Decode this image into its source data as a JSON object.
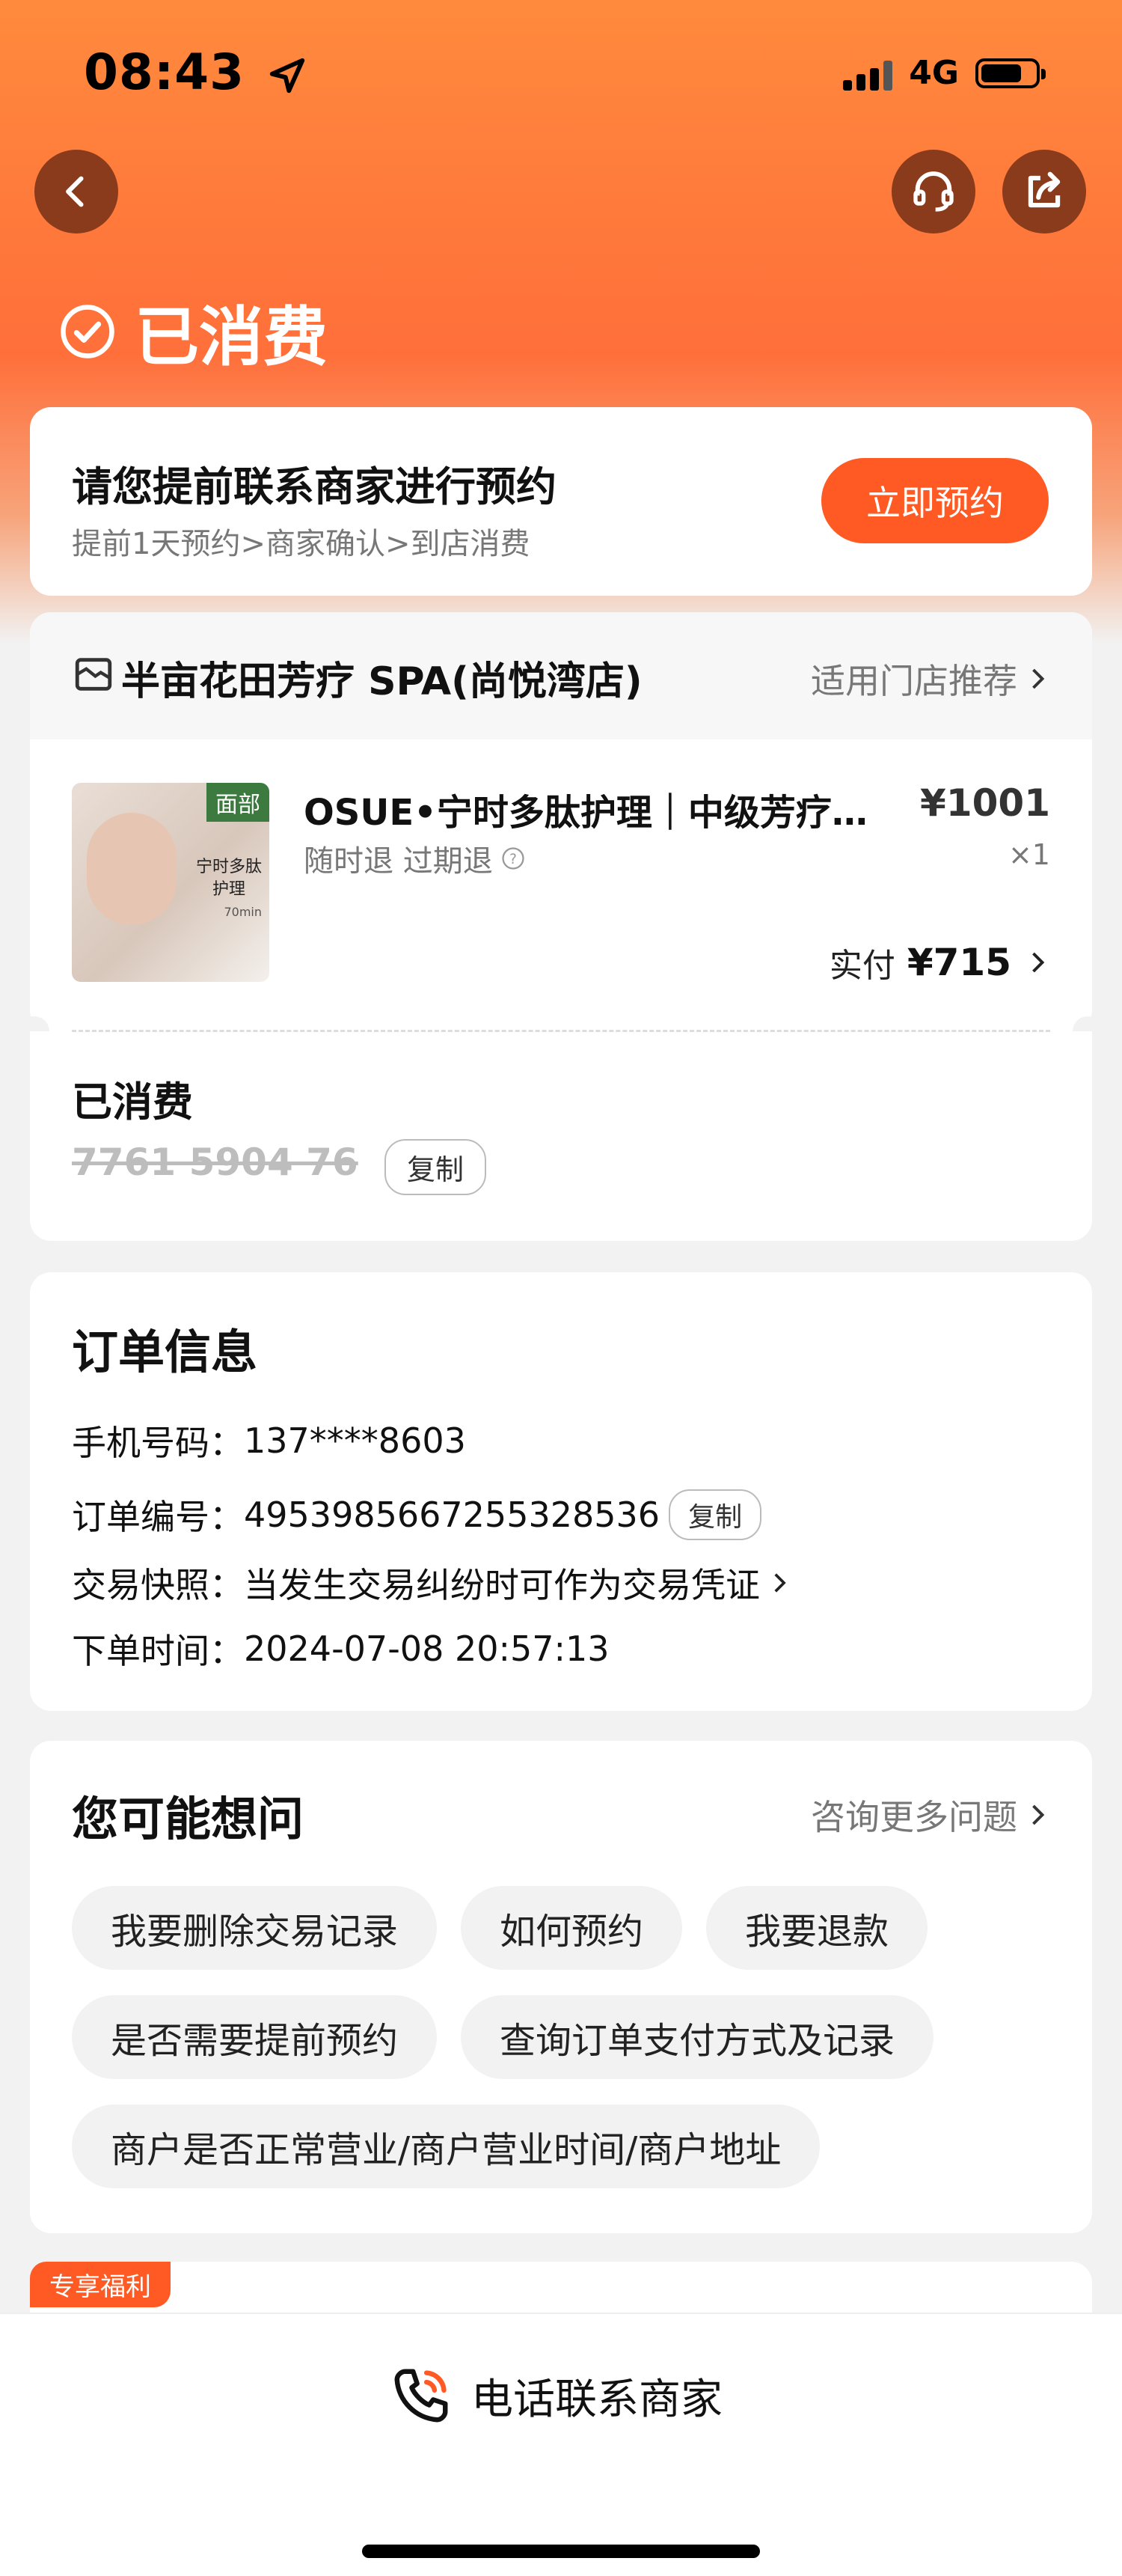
{
  "status_bar": {
    "time": "08:43",
    "network": "4G",
    "battery_level": 0.75
  },
  "header": {
    "status": "已消费"
  },
  "booking": {
    "title": "请您提前联系商家进行预约",
    "subtitle": "提前1天预约>商家确认>到店消费",
    "button": "立即预约"
  },
  "store": {
    "name": "半亩花田芳疗 SPA(尚悦湾店)",
    "recommend": "适用门店推荐"
  },
  "product": {
    "tag": "面部",
    "img_text1": "宁时多肽",
    "img_text2": "护理",
    "img_text3": "70min",
    "title": "OSUE•宁时多肽护理｜中级芳疗…",
    "policy": "随时退 过期退",
    "price": "¥1001",
    "qty": "×1",
    "paid_label": "实付",
    "paid_amount": "¥715"
  },
  "voucher": {
    "status": "已消费",
    "code": "7761 5904 76",
    "copy": "复制"
  },
  "order_info": {
    "title": "订单信息",
    "phone_label": "手机号码：",
    "phone": "137****8603",
    "order_no_label": "订单编号：",
    "order_no": "4953985667255328536",
    "copy": "复制",
    "snapshot_label": "交易快照：",
    "snapshot": "当发生交易纠纷时可作为交易凭证",
    "time_label": "下单时间：",
    "time": "2024-07-08 20:57:13"
  },
  "faq": {
    "title": "您可能想问",
    "more": "咨询更多问题",
    "chips": [
      "我要删除交易记录",
      "如何预约",
      "我要退款",
      "是否需要提前预约",
      "查询订单支付方式及记录",
      "商户是否正常营业/商户营业时间/商户地址"
    ]
  },
  "benefit": {
    "badge": "专享福利"
  },
  "bottom": {
    "call": "电话联系商家"
  },
  "colors": {
    "accent": "#ff5a23",
    "hero": "#ff7a3a"
  }
}
